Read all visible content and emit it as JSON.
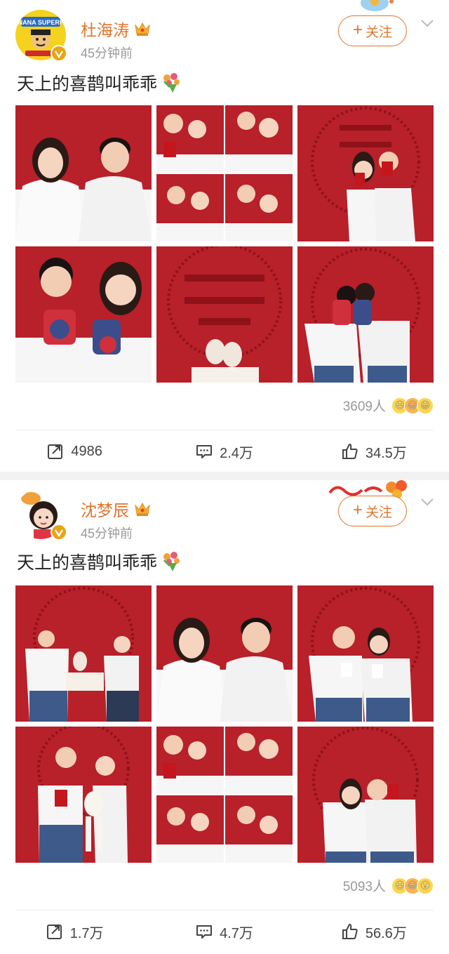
{
  "posts": [
    {
      "username": "杜海涛",
      "time": "45分钟前",
      "follow_label": "关注",
      "text": "天上的喜鹊叫乖乖",
      "avatar_text": "BANANA SUPERFUN",
      "reactions_count": "3609人",
      "actions": {
        "repost": "4986",
        "comment": "2.4万",
        "like": "34.5万"
      }
    },
    {
      "username": "沈梦辰",
      "time": "45分钟前",
      "follow_label": "关注",
      "text": "天上的喜鹊叫乖乖",
      "reactions_count": "5093人",
      "actions": {
        "repost": "1.7万",
        "comment": "4.7万",
        "like": "56.6万"
      }
    }
  ],
  "icons": {
    "verified": "verified-badge-icon",
    "crown": "crown-icon",
    "chevron": "chevron-down-icon",
    "repost": "repost-icon",
    "comment": "comment-icon",
    "like": "thumbs-up-icon",
    "bouquet": "bouquet-icon"
  },
  "colors": {
    "accent": "#e0752c",
    "photo_red": "#b8202a",
    "text": "#222222",
    "muted": "#999999"
  }
}
